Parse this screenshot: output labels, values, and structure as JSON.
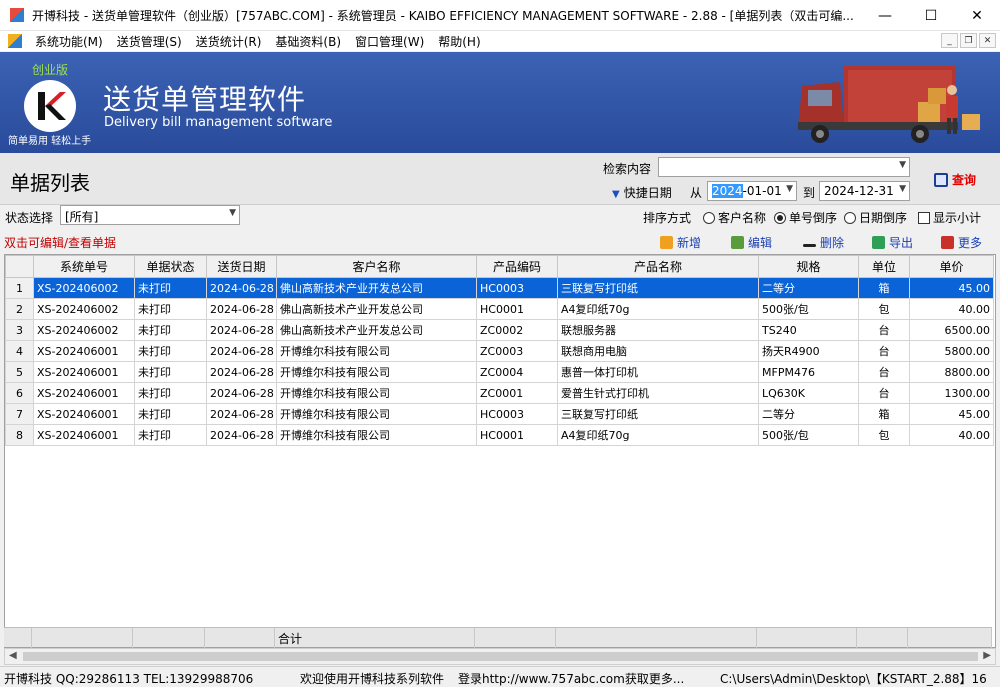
{
  "window": {
    "title": "开博科技 - 送货单管理软件（创业版）[757ABC.COM] - 系统管理员 - KAIBO EFFICIENCY MANAGEMENT SOFTWARE - 2.88 - [单据列表（双击可编...",
    "minimize": "—",
    "maximize": "☐",
    "close": "✕"
  },
  "menu": [
    "系统功能(M)",
    "送货管理(S)",
    "送货统计(R)",
    "基础资料(B)",
    "窗口管理(W)",
    "帮助(H)"
  ],
  "mdi": {
    "min": "_",
    "restore": "❐",
    "close": "✕"
  },
  "banner": {
    "edition": "创业版",
    "title": "送货单管理软件",
    "subtitle": "Delivery bill management software",
    "slogan": "简单易用  轻松上手"
  },
  "panel": {
    "page_title": "单据列表",
    "search_label": "检索内容",
    "search_value": "",
    "quick_date_label": "快捷日期",
    "from_label": "从",
    "date_from_sel": "2024",
    "date_from_rest": "-01-01",
    "to_label": "到",
    "date_to": "2024-12-31",
    "query_label": "查询"
  },
  "filter": {
    "status_label": "状态选择",
    "status_value": "[所有]",
    "sort_label": "排序方式",
    "sort_customer": "客户名称",
    "sort_number_desc": "单号倒序",
    "sort_date_desc": "日期倒序",
    "sort_selected": "单号倒序",
    "show_subtotal": "显示小计",
    "show_subtotal_checked": false
  },
  "toolbar": {
    "hint": "双击可编辑/查看单据",
    "add": "新增",
    "edit": "编辑",
    "delete": "删除",
    "export": "导出",
    "more": "更多"
  },
  "table": {
    "columns": [
      "",
      "系统单号",
      "单据状态",
      "送货日期",
      "客户名称",
      "产品编码",
      "产品名称",
      "规格",
      "单位",
      "单价"
    ],
    "rows": [
      [
        "1",
        "XS-202406002",
        "未打印",
        "2024-06-28",
        "佛山高新技术产业开发总公司",
        "HC0003",
        "三联复写打印纸",
        "二等分",
        "箱",
        "45.00"
      ],
      [
        "2",
        "XS-202406002",
        "未打印",
        "2024-06-28",
        "佛山高新技术产业开发总公司",
        "HC0001",
        "A4复印纸70g",
        "500张/包",
        "包",
        "40.00"
      ],
      [
        "3",
        "XS-202406002",
        "未打印",
        "2024-06-28",
        "佛山高新技术产业开发总公司",
        "ZC0002",
        "联想服务器",
        "TS240",
        "台",
        "6500.00"
      ],
      [
        "4",
        "XS-202406001",
        "未打印",
        "2024-06-28",
        "开博维尔科技有限公司",
        "ZC0003",
        "联想商用电脑",
        "扬天R4900",
        "台",
        "5800.00"
      ],
      [
        "5",
        "XS-202406001",
        "未打印",
        "2024-06-28",
        "开博维尔科技有限公司",
        "ZC0004",
        "惠普一体打印机",
        "MFPM476",
        "台",
        "8800.00"
      ],
      [
        "6",
        "XS-202406001",
        "未打印",
        "2024-06-28",
        "开博维尔科技有限公司",
        "ZC0001",
        "爱普生针式打印机",
        "LQ630K",
        "台",
        "1300.00"
      ],
      [
        "7",
        "XS-202406001",
        "未打印",
        "2024-06-28",
        "开博维尔科技有限公司",
        "HC0003",
        "三联复写打印纸",
        "二等分",
        "箱",
        "45.00"
      ],
      [
        "8",
        "XS-202406001",
        "未打印",
        "2024-06-28",
        "开博维尔科技有限公司",
        "HC0001",
        "A4复印纸70g",
        "500张/包",
        "包",
        "40.00"
      ]
    ],
    "selected_row": 1,
    "total_label": "合计"
  },
  "status": {
    "company": "开博科技 QQ:29286113 TEL:13929988706",
    "welcome": "欢迎使用开博科技系列软件",
    "login": "登录http://www.757abc.com获取更多...",
    "path": "C:\\Users\\Admin\\Desktop\\【KSTART_2.88】16"
  },
  "colors": {
    "accent": "#0a64d8",
    "banner": "#2f56a8",
    "hint": "#c00000",
    "query": "#e00000"
  }
}
